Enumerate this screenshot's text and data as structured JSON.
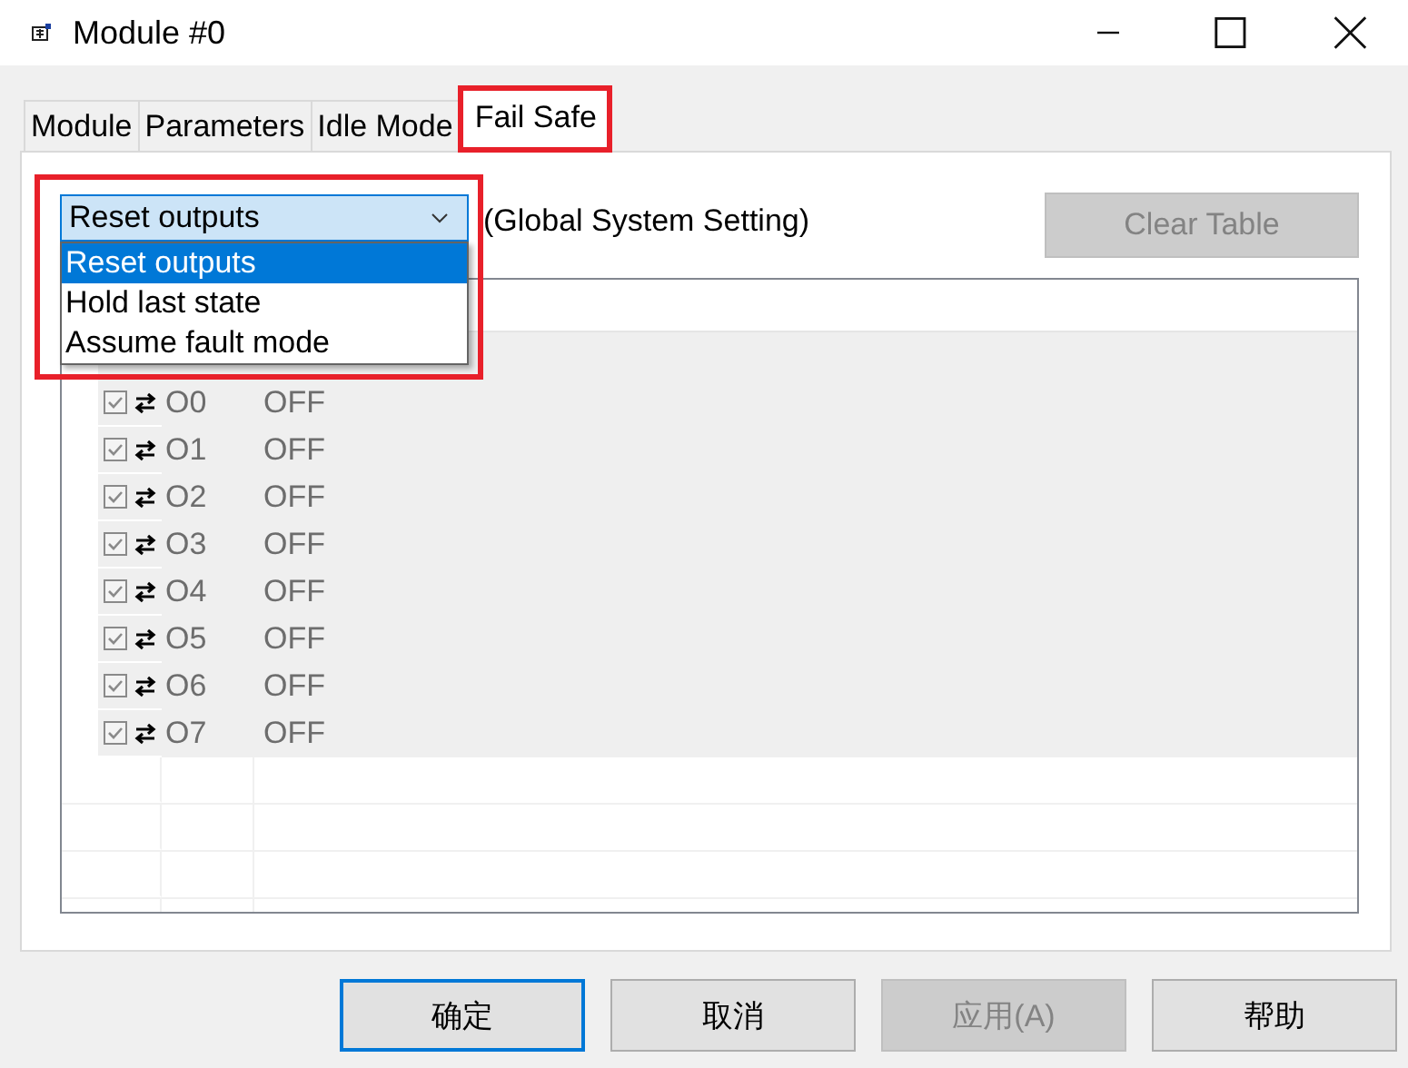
{
  "window": {
    "title": "Module #0"
  },
  "tabs": [
    {
      "label": "Module",
      "selected": false,
      "highlighted": false
    },
    {
      "label": "Parameters",
      "selected": false,
      "highlighted": false
    },
    {
      "label": "Idle Mode",
      "selected": false,
      "highlighted": false
    },
    {
      "label": "Fail Safe",
      "selected": true,
      "highlighted": true
    }
  ],
  "mode_dropdown": {
    "value": "Reset outputs",
    "expanded": true,
    "highlighted": true,
    "options": [
      {
        "label": "Reset outputs",
        "selected": true
      },
      {
        "label": "Hold last state",
        "selected": false
      },
      {
        "label": "Assume fault mode",
        "selected": false
      }
    ]
  },
  "scope_label": "(Global System Setting)",
  "clear_button": {
    "label": "Clear Table",
    "disabled": true
  },
  "table": {
    "rows": [
      {
        "checked": true,
        "name": "O0",
        "value": "OFF"
      },
      {
        "checked": true,
        "name": "O1",
        "value": "OFF"
      },
      {
        "checked": true,
        "name": "O2",
        "value": "OFF"
      },
      {
        "checked": true,
        "name": "O3",
        "value": "OFF"
      },
      {
        "checked": true,
        "name": "O4",
        "value": "OFF"
      },
      {
        "checked": true,
        "name": "O5",
        "value": "OFF"
      },
      {
        "checked": true,
        "name": "O6",
        "value": "OFF"
      },
      {
        "checked": true,
        "name": "O7",
        "value": "OFF"
      }
    ]
  },
  "buttons": [
    {
      "label": "确定",
      "default": true,
      "disabled": false
    },
    {
      "label": "取消",
      "default": false,
      "disabled": false
    },
    {
      "label": "应用(A)",
      "default": false,
      "disabled": true
    },
    {
      "label": "帮助",
      "default": false,
      "disabled": false
    }
  ]
}
